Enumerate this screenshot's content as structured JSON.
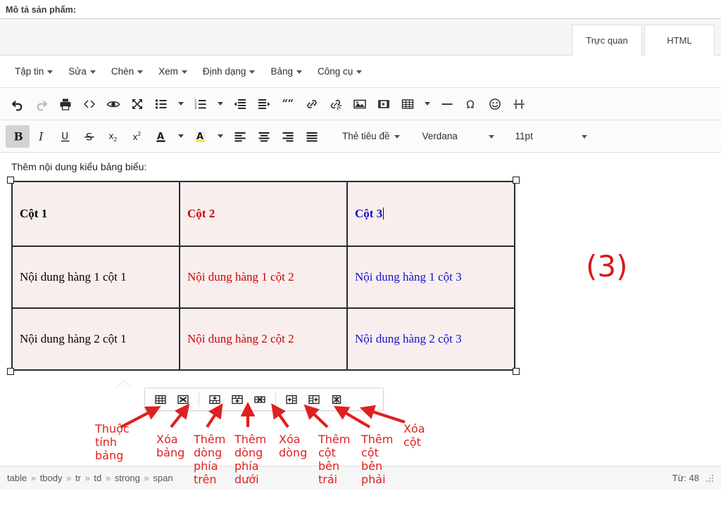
{
  "page": {
    "label": "Mô tả sản phẩm:"
  },
  "tabs": [
    {
      "label": "Trực quan",
      "name": "tab-visual"
    },
    {
      "label": "HTML",
      "name": "tab-html"
    }
  ],
  "menubar": [
    {
      "label": "Tập tin"
    },
    {
      "label": "Sửa"
    },
    {
      "label": "Chèn"
    },
    {
      "label": "Xem"
    },
    {
      "label": "Định dạng"
    },
    {
      "label": "Bảng"
    },
    {
      "label": "Công cụ"
    }
  ],
  "toolbar_row1": [
    {
      "icon": "undo-icon",
      "title": "Hoàn tác"
    },
    {
      "icon": "redo-icon",
      "title": "Làm lại"
    },
    {
      "icon": "print-icon",
      "title": "In"
    },
    {
      "icon": "source-code-icon",
      "title": "Mã nguồn"
    },
    {
      "icon": "preview-eye-icon",
      "title": "Xem trước"
    },
    {
      "icon": "fullscreen-icon",
      "title": "Toàn màn hình"
    },
    {
      "icon": "bullet-list-icon",
      "title": "Danh sách không thứ tự"
    },
    {
      "icon": "numbered-list-icon",
      "title": "Danh sách có thứ tự"
    },
    {
      "icon": "outdent-icon",
      "title": "Giảm thụt lề"
    },
    {
      "icon": "indent-icon",
      "title": "Tăng thụt lề"
    },
    {
      "icon": "blockquote-icon",
      "title": "Trích dẫn"
    },
    {
      "icon": "link-icon",
      "title": "Chèn liên kết"
    },
    {
      "icon": "unlink-icon",
      "title": "Bỏ liên kết"
    },
    {
      "icon": "image-icon",
      "title": "Chèn ảnh"
    },
    {
      "icon": "media-icon",
      "title": "Chèn media"
    },
    {
      "icon": "table-icon",
      "title": "Bảng"
    },
    {
      "icon": "horizontal-rule-icon",
      "title": "Đường kẻ ngang"
    },
    {
      "icon": "special-char-icon",
      "title": "Ký tự đặc biệt"
    },
    {
      "icon": "emoticon-icon",
      "title": "Biểu tượng cảm xúc"
    },
    {
      "icon": "page-break-icon",
      "title": "Ngắt trang"
    }
  ],
  "toolbar_row2": {
    "buttons": [
      {
        "icon": "bold-icon",
        "glyph": "B",
        "active": true
      },
      {
        "icon": "italic-icon",
        "glyph": "I",
        "active": false
      },
      {
        "icon": "underline-icon",
        "glyph": "U",
        "active": false
      },
      {
        "icon": "strikethrough-icon",
        "glyph": "S",
        "active": false
      },
      {
        "icon": "subscript-icon",
        "glyph": "x₂",
        "active": false
      },
      {
        "icon": "superscript-icon",
        "glyph": "x²",
        "active": false
      },
      {
        "icon": "text-color-icon",
        "glyph": "A",
        "active": false
      },
      {
        "icon": "background-color-icon",
        "glyph": "A",
        "active": false
      },
      {
        "icon": "align-left-icon",
        "glyph": "",
        "active": false
      },
      {
        "icon": "align-center-icon",
        "glyph": "",
        "active": false
      },
      {
        "icon": "align-right-icon",
        "glyph": "",
        "active": false
      },
      {
        "icon": "align-justify-icon",
        "glyph": "",
        "active": false
      }
    ],
    "format_select": "Thẻ tiêu đề",
    "font_select": "Verdana",
    "size_select": "11pt"
  },
  "content": {
    "intro": "Thêm nội dung kiểu bảng biểu:",
    "table": {
      "header": [
        {
          "text": "Cột 1",
          "color": "black"
        },
        {
          "text": "Cột 2",
          "color": "red"
        },
        {
          "text": "Cột 3",
          "color": "blue",
          "caret": true
        }
      ],
      "rows": [
        [
          {
            "text": "Nội dung hàng 1 cột 1",
            "color": "black"
          },
          {
            "text": "Nội dung hàng 1 cột 2",
            "color": "red"
          },
          {
            "text": "Nội dung hàng 1 cột 3",
            "color": "blue"
          }
        ],
        [
          {
            "text": "Nội dung hàng 2 cột 1",
            "color": "black"
          },
          {
            "text": "Nội dung hàng 2 cột 2",
            "color": "red"
          },
          {
            "text": "Nội dung hàng 2 cột 3",
            "color": "blue"
          }
        ]
      ]
    }
  },
  "table_popup": [
    {
      "icon": "table-properties-icon",
      "label": "Thuộc tính bảng"
    },
    {
      "icon": "delete-table-icon",
      "label": "Xóa bảng"
    },
    {
      "icon": "insert-row-before-icon",
      "label": "Thêm dòng phía trên"
    },
    {
      "icon": "insert-row-after-icon",
      "label": "Thêm dòng phía dưới"
    },
    {
      "icon": "delete-row-icon",
      "label": "Xóa dòng"
    },
    {
      "icon": "insert-column-before-icon",
      "label": "Thêm cột bên trái"
    },
    {
      "icon": "insert-column-after-icon",
      "label": "Thêm cột bên phải"
    },
    {
      "icon": "delete-column-icon",
      "label": "Xóa cột"
    }
  ],
  "annotations": {
    "step_marker": "(3)",
    "labels": [
      "Thuộc\ntính\nbảng",
      "Xóa\nbảng",
      "Thêm\ndòng\nphía\ntrên",
      "Thêm\ndòng\nphía\ndưới",
      "Xóa\ndòng",
      "Thêm\ncột\nbên\ntrái",
      "Thêm\ncột\nbên\nphải",
      "Xóa\ncột"
    ]
  },
  "statusbar": {
    "path": [
      "table",
      "tbody",
      "tr",
      "td",
      "strong",
      "span"
    ],
    "path_separator": "»",
    "wordcount": "Từ: 48"
  },
  "colors": {
    "annotation_red": "#e02020",
    "table_cell_bg": "#f8eeee",
    "text_red": "#cc0000",
    "text_blue": "#1111cc"
  }
}
